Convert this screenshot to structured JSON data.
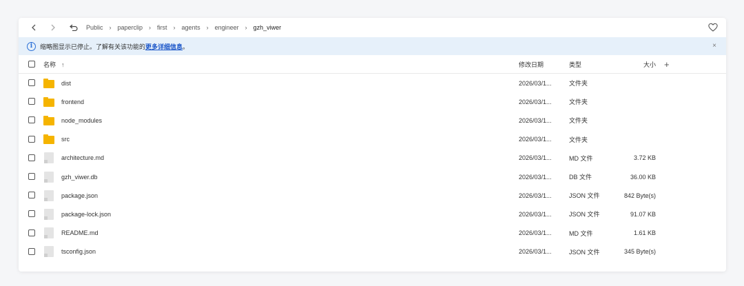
{
  "toolbar": {
    "back_icon": "chevron-left-icon",
    "forward_icon": "chevron-right-icon",
    "up_icon": "undo-arrow-icon",
    "breadcrumb": [
      "Public",
      "paperclip",
      "first",
      "agents",
      "engineer",
      "gzh_viwer"
    ],
    "favorite_icon": "heart-icon"
  },
  "notice": {
    "text": "缩略图显示已停止。了解有关该功能的",
    "link": "更多详细信息",
    "suffix": "。",
    "close": "×"
  },
  "columns": {
    "name": "名称",
    "sort_arrow": "↑",
    "date": "修改日期",
    "type": "类型",
    "size": "大小",
    "add": "+"
  },
  "files": [
    {
      "name": "dist",
      "date": "2026/03/1...",
      "type": "文件夹",
      "size": "",
      "kind": "folder"
    },
    {
      "name": "frontend",
      "date": "2026/03/1...",
      "type": "文件夹",
      "size": "",
      "kind": "folder"
    },
    {
      "name": "node_modules",
      "date": "2026/03/1...",
      "type": "文件夹",
      "size": "",
      "kind": "folder"
    },
    {
      "name": "src",
      "date": "2026/03/1...",
      "type": "文件夹",
      "size": "",
      "kind": "folder"
    },
    {
      "name": "architecture.md",
      "date": "2026/03/1...",
      "type": "MD 文件",
      "size": "3.72 KB",
      "kind": "file"
    },
    {
      "name": "gzh_viwer.db",
      "date": "2026/03/1...",
      "type": "DB 文件",
      "size": "36.00 KB",
      "kind": "file"
    },
    {
      "name": "package.json",
      "date": "2026/03/1...",
      "type": "JSON 文件",
      "size": "842 Byte(s)",
      "kind": "file"
    },
    {
      "name": "package-lock.json",
      "date": "2026/03/1...",
      "type": "JSON 文件",
      "size": "91.07 KB",
      "kind": "file"
    },
    {
      "name": "README.md",
      "date": "2026/03/1...",
      "type": "MD 文件",
      "size": "1.61 KB",
      "kind": "file"
    },
    {
      "name": "tsconfig.json",
      "date": "2026/03/1...",
      "type": "JSON 文件",
      "size": "345 Byte(s)",
      "kind": "file"
    }
  ],
  "colors": {
    "folder": "#f5b400",
    "notice_bg": "#e6f0fa",
    "link": "#1a55c8"
  }
}
